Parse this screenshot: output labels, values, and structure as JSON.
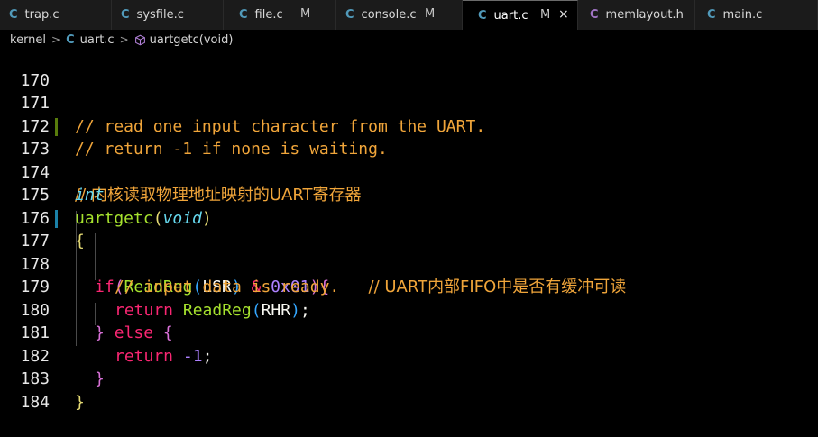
{
  "tabs": [
    {
      "icon": "C",
      "icon_color": "#519aba",
      "label": "trap.c",
      "modified": "",
      "active": false
    },
    {
      "icon": "C",
      "icon_color": "#519aba",
      "label": "sysfile.c",
      "modified": "",
      "active": false
    },
    {
      "icon": "C",
      "icon_color": "#519aba",
      "label": "file.c",
      "modified": "M",
      "active": false
    },
    {
      "icon": "C",
      "icon_color": "#519aba",
      "label": "console.c",
      "modified": "M",
      "active": false
    },
    {
      "icon": "C",
      "icon_color": "#519aba",
      "label": "uart.c",
      "modified": "M",
      "active": true,
      "close": "×"
    },
    {
      "icon": "C",
      "icon_color": "#a074c4",
      "label": "memlayout.h",
      "modified": "",
      "active": false
    },
    {
      "icon": "C",
      "icon_color": "#519aba",
      "label": "main.c",
      "modified": "",
      "active": false
    }
  ],
  "breadcrumb": {
    "folder": "kernel",
    "separator": ">",
    "file_icon": "C",
    "file": "uart.c",
    "symbol": "uartgetc(void)"
  },
  "editor": {
    "line_numbers": [
      "170",
      "171",
      "172",
      "173",
      "174",
      "175",
      "176",
      "177",
      "178",
      "179",
      "180",
      "181",
      "182",
      "183",
      "184"
    ],
    "code": {
      "l171": "// read one input character from the UART.",
      "l172": "// return -1 if none is waiting.",
      "l173": "// 内核读取物理地址映射的UART寄存器",
      "l174": "int",
      "l175_fn": "uartgetc",
      "l175_open": "(",
      "l175_type": "void",
      "l175_close": ")",
      "l176": "{",
      "l177_kw": "if",
      "l177_open": "(",
      "l177_fn": "ReadReg",
      "l177_open2": "(",
      "l177_arg": "LSR",
      "l177_close2": ")",
      "l177_op": "&",
      "l177_num": "0x01",
      "l177_close": ")",
      "l177_brace": "{",
      "l177_comment": "// UART内部FIFO中是否有缓冲可读",
      "l178": "// input data is ready.",
      "l179_kw": "return",
      "l179_fn": "ReadReg",
      "l179_open": "(",
      "l179_arg": "RHR",
      "l179_close": ")",
      "l179_semi": ";",
      "l180_brace": "}",
      "l180_kw": "else",
      "l180_open": "{",
      "l181_kw": "return",
      "l181_num": "-1",
      "l181_semi": ";",
      "l182": "}",
      "l183": "}"
    }
  },
  "colors": {
    "comment": "#f0a53a",
    "type": "#66d9ef",
    "function": "#a6e22e",
    "keyword": "#f92672",
    "number": "#ae81ff",
    "gutter_added": "#587c0c",
    "gutter_modified": "#1b81a8"
  }
}
